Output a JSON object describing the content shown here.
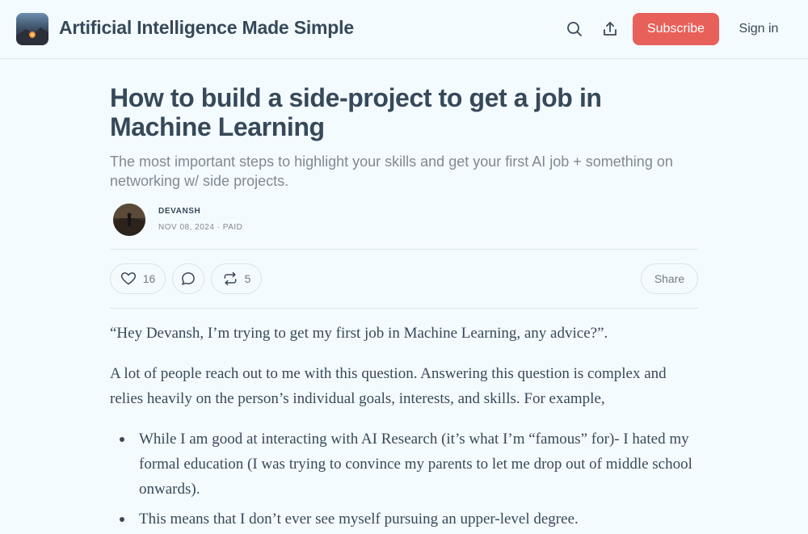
{
  "header": {
    "publication_title": "Artificial Intelligence Made Simple",
    "subscribe_label": "Subscribe",
    "signin_label": "Sign in",
    "icons": [
      "search-icon",
      "share-upload-icon"
    ],
    "accent_color": "#e8605a"
  },
  "article": {
    "title": "How to build a side-project to get a job in Machine Learning",
    "subtitle": "The most important steps to highlight your skills and get your first AI job + something on networking w/ side projects.",
    "author": "DEVANSH",
    "meta": "NOV 08, 2024 · PAID",
    "actions": {
      "likes": "16",
      "restacks": "5",
      "share_label": "Share"
    },
    "paragraphs": [
      "“Hey Devansh, I’m trying to get my first job in Machine Learning, any advice?”.",
      "A lot of people reach out to me with this question. Answering this question is complex and relies heavily on the person’s individual goals, interests, and skills. For example,"
    ],
    "bullets": [
      "While I am good at interacting with AI Research (it’s what I’m “famous” for)- I hated my formal education (I was trying to convince my parents to let me drop out of middle school onwards).",
      "This means that I don’t ever see myself pursuing an upper-level degree."
    ]
  }
}
